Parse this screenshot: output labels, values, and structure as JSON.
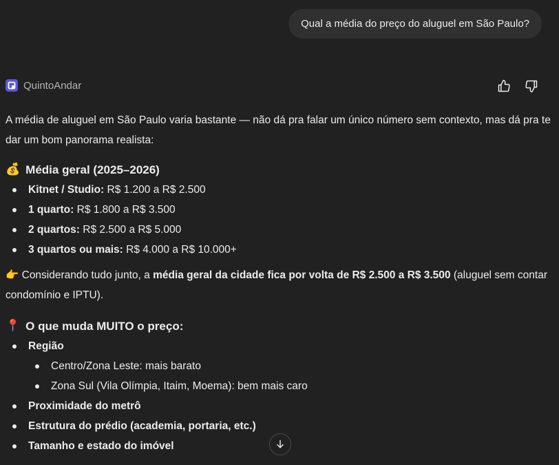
{
  "user_message": "Qual a média do preço do aluguel em São Paulo?",
  "assistant": {
    "name": "QuintoAndar",
    "brand_color": "#5b55e6"
  },
  "feedback": {
    "thumbs_up_icon": "thumbs-up-icon",
    "thumbs_down_icon": "thumbs-down-icon"
  },
  "response": {
    "intro": "A média de aluguel em São Paulo varia bastante — não dá pra falar um único número sem contexto, mas dá pra te dar um bom panorama realista:",
    "section1": {
      "emoji": "💰",
      "title": "Média geral (2025–2026)",
      "items": [
        {
          "label": "Kitnet / Studio:",
          "value": " R$ 1.200 a R$ 2.500"
        },
        {
          "label": "1 quarto:",
          "value": " R$ 1.800 a R$ 3.500"
        },
        {
          "label": "2 quartos:",
          "value": " R$ 2.500 a R$ 5.000"
        },
        {
          "label": "3 quartos ou mais:",
          "value": " R$ 4.000 a R$ 10.000+"
        }
      ]
    },
    "summary": {
      "emoji": "👉",
      "pre": " Considerando tudo junto, a ",
      "bold": "média geral da cidade fica por volta de R$ 2.500 a R$ 3.500",
      "post": " (aluguel sem contar condomínio e IPTU)."
    },
    "section2": {
      "emoji": "📍",
      "title": "O que muda MUITO o preço:",
      "items": [
        {
          "label": "Região",
          "subitems": [
            "Centro/Zona Leste: mais barato",
            "Zona Sul (Vila Olímpia, Itaim, Moema): bem mais caro"
          ]
        },
        {
          "label": "Proximidade do metrô"
        },
        {
          "label": "Estrutura do prédio (academia, portaria, etc.)"
        },
        {
          "label": "Tamanho e estado do imóvel"
        }
      ]
    }
  },
  "scroll_button_icon": "arrow-down-icon"
}
